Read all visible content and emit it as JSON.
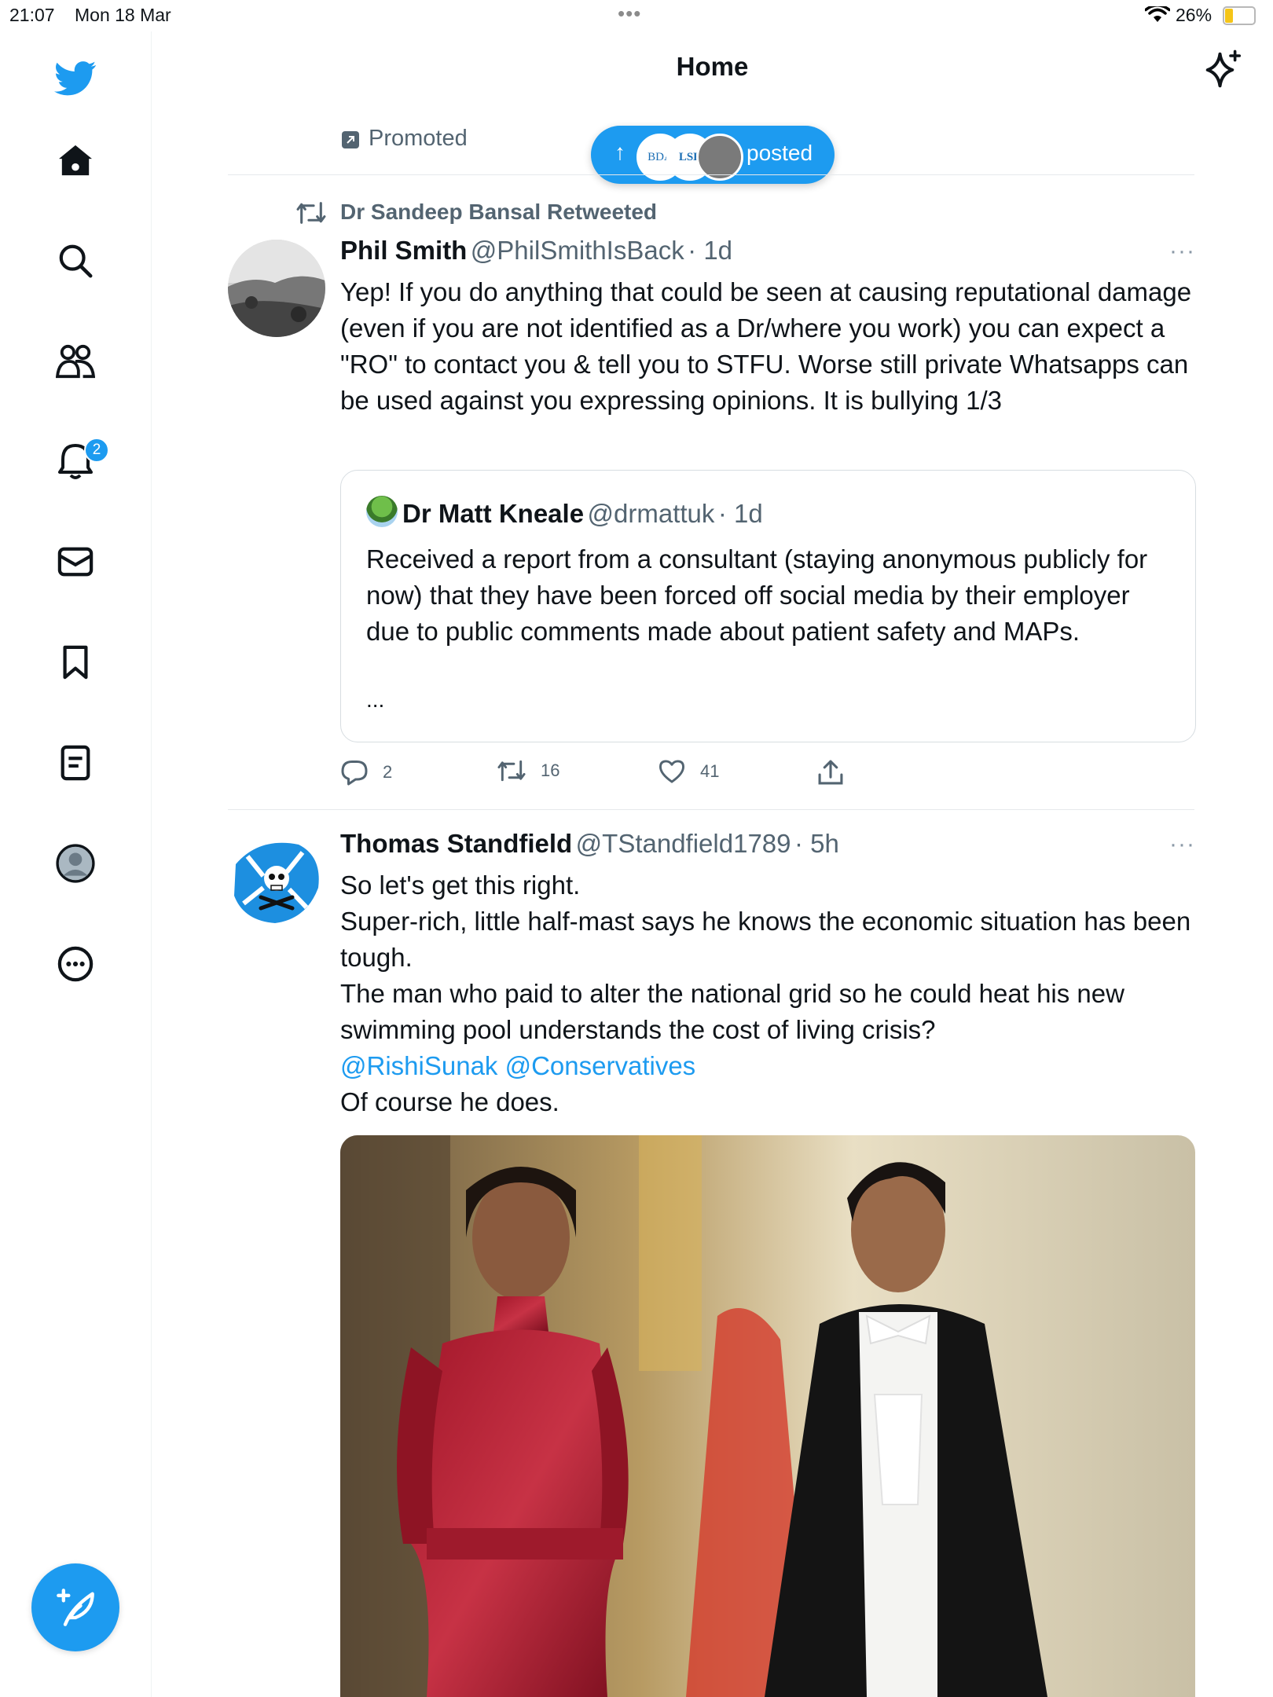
{
  "status_bar": {
    "time": "21:07",
    "date": "Mon 18 Mar",
    "battery": "26%"
  },
  "header": {
    "title": "Home"
  },
  "sidebar": {
    "items": [
      {
        "name": "home",
        "icon": "home-icon"
      },
      {
        "name": "explore",
        "icon": "search-icon"
      },
      {
        "name": "communities",
        "icon": "people-icon"
      },
      {
        "name": "notifications",
        "icon": "bell-icon",
        "badge": "2"
      },
      {
        "name": "messages",
        "icon": "mail-icon"
      },
      {
        "name": "bookmarks",
        "icon": "bookmark-icon"
      },
      {
        "name": "lists",
        "icon": "list-icon"
      },
      {
        "name": "profile",
        "icon": "profile-icon"
      },
      {
        "name": "more",
        "icon": "more-circle-icon"
      }
    ]
  },
  "feed": {
    "promoted_label": "Promoted",
    "new_posts_pill": {
      "label": "posted",
      "avatar_labels": [
        "BDA",
        "LSE"
      ]
    },
    "tweets": [
      {
        "retweeted_by": "Dr Sandeep Bansal Retweeted",
        "name": "Phil Smith",
        "handle": "@PhilSmithIsBack",
        "time": "· 1d",
        "more": "···",
        "text": "Yep! If you do anything that could be seen at causing reputational damage (even if you are not identified as a Dr/where you work) you can expect a \"RO\" to contact you & tell you to STFU. Worse still private Whatsapps can be used against you expressing opinions. It is bullying 1/3",
        "quote": {
          "name": "Dr Matt Kneale",
          "handle": "@drmattuk",
          "time": "· 1d",
          "text": "Received a report from a consultant (staying anonymous publicly for now) that they have been forced off social media by their employer due to public comments made about patient safety and MAPs.",
          "ellipsis": "..."
        },
        "replies": "2",
        "retweets": "16",
        "likes": "41"
      },
      {
        "name": "Thomas Standfield",
        "handle": "@TStandfield1789",
        "time": "· 5h",
        "more": "···",
        "lines": [
          "So let's get this right.",
          "Super-rich, little half-mast says he knows the economic situation has been tough.",
          "The man who paid to alter the national grid so he could heat his new swimming pool understands the cost of living crisis?"
        ],
        "mentions": [
          "@RishiSunak",
          "@Conservatives"
        ],
        "closing": "Of course he does."
      }
    ]
  },
  "colors": {
    "accent": "#1d9bf0",
    "text": "#0f1419",
    "secondary": "#536471"
  }
}
